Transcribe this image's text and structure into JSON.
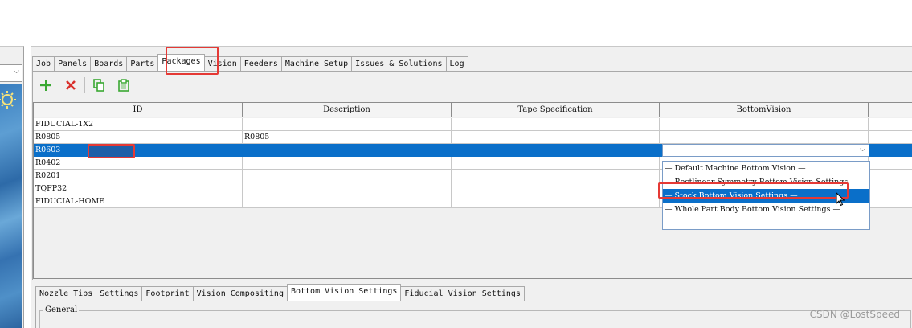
{
  "left_panel": {
    "combo_arrow": "⌵",
    "sun_icon": "sun-icon"
  },
  "top_tabs": [
    {
      "label": "Job"
    },
    {
      "label": "Panels"
    },
    {
      "label": "Boards"
    },
    {
      "label": "Parts"
    },
    {
      "label": "Packages",
      "active": true
    },
    {
      "label": "Vision"
    },
    {
      "label": "Feeders"
    },
    {
      "label": "Machine Setup"
    },
    {
      "label": "Issues & Solutions"
    },
    {
      "label": "Log"
    }
  ],
  "toolbar": {
    "add_icon": "plus-icon",
    "delete_icon": "x-icon",
    "copy_icon": "copy-icon",
    "paste_icon": "paste-icon",
    "colors": {
      "add": "#3aa832",
      "delete": "#d9302c",
      "copy": "#3aa832"
    }
  },
  "table": {
    "headers": [
      "ID",
      "Description",
      "Tape Specification",
      "BottomVision"
    ],
    "rows": [
      {
        "id": "FIDUCIAL-1X2",
        "description": "",
        "tape": "",
        "bottom_vision": ""
      },
      {
        "id": "R0805",
        "description": "R0805",
        "tape": "",
        "bottom_vision": ""
      },
      {
        "id": "R0603",
        "description": "",
        "tape": "",
        "bottom_vision": "",
        "selected": true
      },
      {
        "id": "R0402",
        "description": "",
        "tape": "",
        "bottom_vision": ""
      },
      {
        "id": "R0201",
        "description": "",
        "tape": "",
        "bottom_vision": ""
      },
      {
        "id": "TQFP32",
        "description": "",
        "tape": "",
        "bottom_vision": ""
      },
      {
        "id": "FIDUCIAL-HOME",
        "description": "",
        "tape": "",
        "bottom_vision": ""
      }
    ]
  },
  "bottom_vision_dropdown": {
    "arrow": "⌵",
    "options": [
      {
        "label": "— Default Machine Bottom Vision —"
      },
      {
        "label": "— Rectlinear Symmetry Bottom Vision Settings —"
      },
      {
        "label": "— Stock Bottom Vision Settings —",
        "selected": true
      },
      {
        "label": "— Whole Part Body Bottom Vision Settings —"
      }
    ]
  },
  "bottom_tabs": [
    {
      "label": "Nozzle Tips"
    },
    {
      "label": "Settings"
    },
    {
      "label": "Footprint"
    },
    {
      "label": "Vision Compositing"
    },
    {
      "label": "Bottom Vision Settings",
      "active": true
    },
    {
      "label": "Fiducial Vision Settings"
    }
  ],
  "general_section": {
    "label": "General"
  },
  "highlight_color": "#e53935",
  "selection_color": "#0a6fc9",
  "watermark": "CSDN @LostSpeed"
}
